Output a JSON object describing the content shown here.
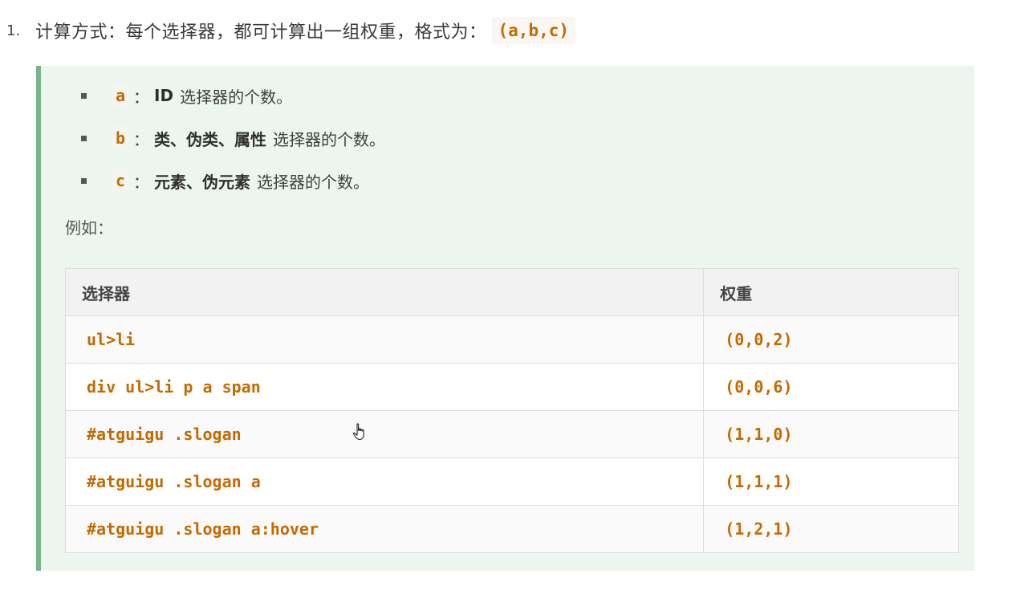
{
  "list_item": {
    "number": "1.",
    "text": "计算方式：每个选择器，都可计算出一组权重，格式为：",
    "format_code": "(a,b,c)"
  },
  "bullets": [
    {
      "key": "a",
      "sep": "：",
      "strong": "ID",
      "rest": "选择器的个数。"
    },
    {
      "key": "b",
      "sep": "：",
      "strong": "类、伪类、属性",
      "rest": "选择器的个数。"
    },
    {
      "key": "c",
      "sep": "：",
      "strong": "元素、伪元素",
      "rest": "选择器的个数。"
    }
  ],
  "example_label": "例如：",
  "table": {
    "headers": [
      "选择器",
      "权重"
    ],
    "rows": [
      {
        "selector": "ul>li",
        "weight": "(0,0,2)"
      },
      {
        "selector": "div ul>li p a span",
        "weight": "(0,0,6)"
      },
      {
        "selector": "#atguigu .slogan",
        "weight": "(1,1,0)"
      },
      {
        "selector": "#atguigu .slogan a",
        "weight": "(1,1,1)"
      },
      {
        "selector": "#atguigu .slogan a:hover",
        "weight": "(1,2,1)"
      }
    ]
  },
  "colors": {
    "code": "#c46a00",
    "quote_background": "#edf6ee",
    "quote_border": "#7bb38a"
  },
  "icons": {
    "cursor": "hand-pointer-icon"
  }
}
